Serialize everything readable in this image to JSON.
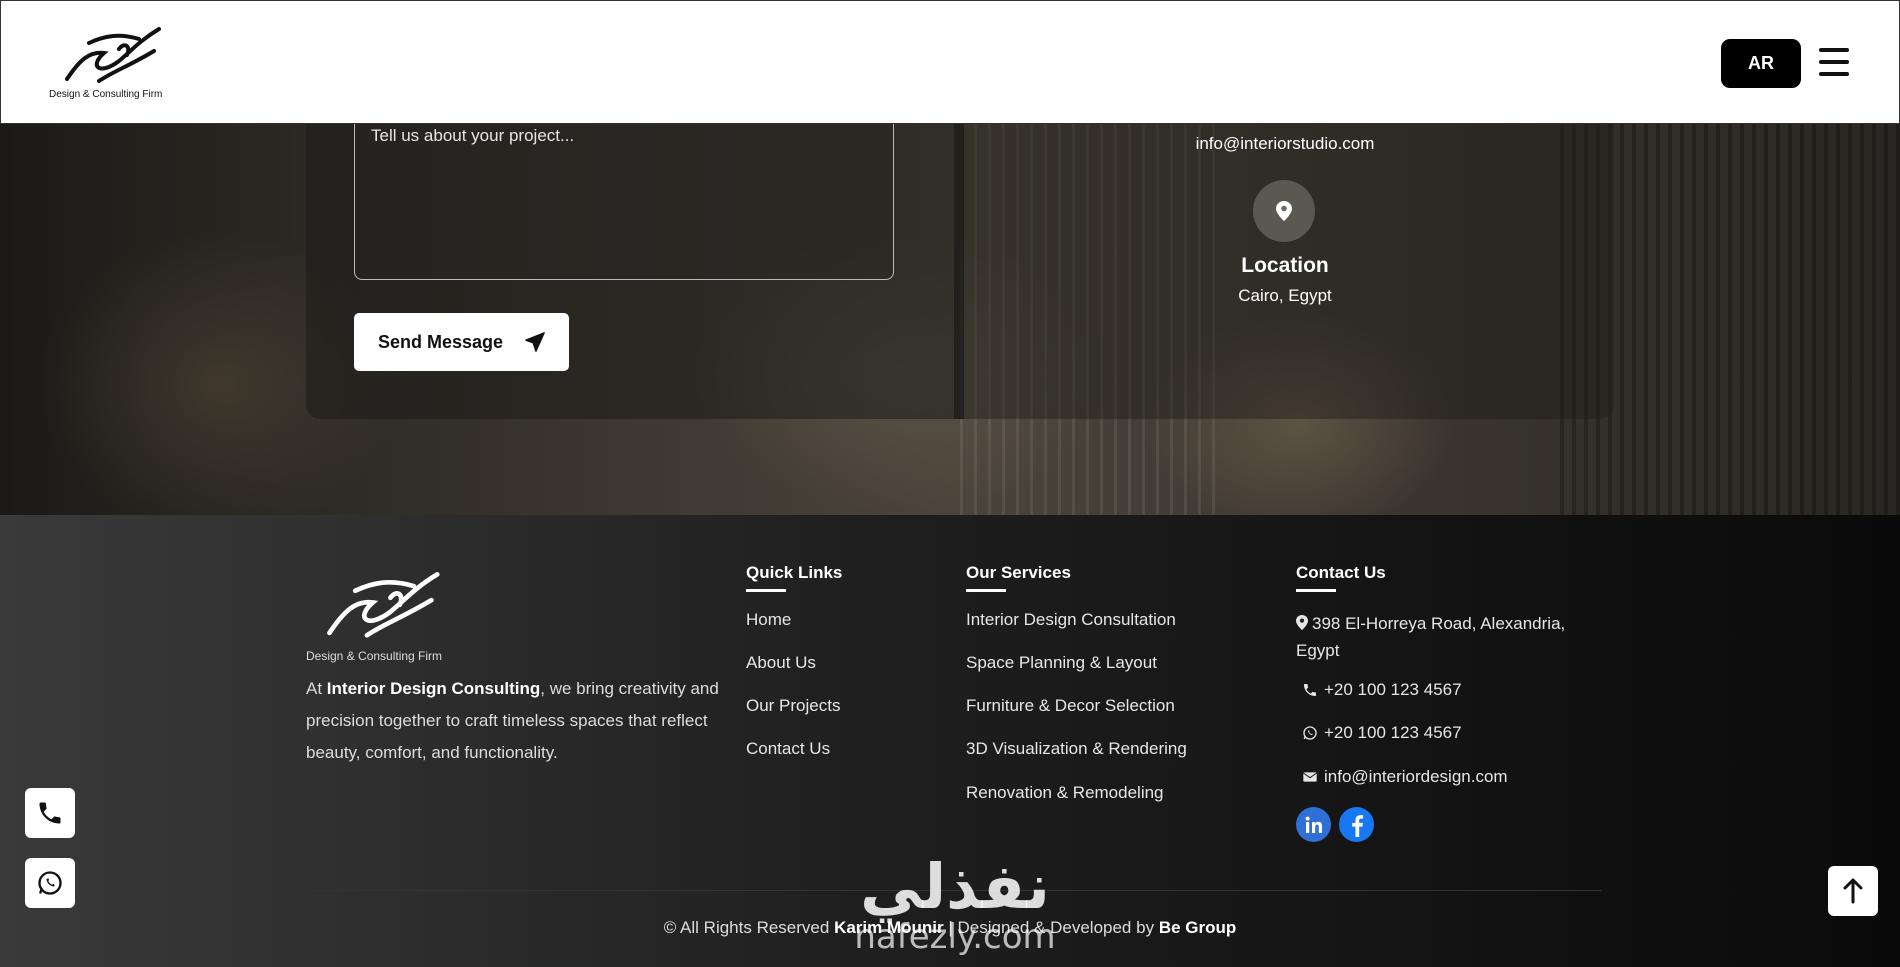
{
  "header": {
    "logo_subtitle": "Design & Consulting Firm",
    "lang_label": "AR"
  },
  "contact_form": {
    "message_placeholder": "Tell us about your project...",
    "send_label": "Send Message"
  },
  "contact_info": {
    "email": "info@interiorstudio.com",
    "location_title": "Location",
    "location_value": "Cairo, Egypt"
  },
  "footer": {
    "logo_subtitle": "Design & Consulting Firm",
    "about_prefix": "At ",
    "about_brand": "Interior Design Consulting",
    "about_suffix": ", we bring creativity and precision together to craft timeless spaces that reflect beauty, comfort, and functionality.",
    "quick_links": {
      "title": "Quick Links",
      "items": [
        "Home",
        "About Us",
        "Our Projects",
        "Contact Us"
      ]
    },
    "services": {
      "title": "Our Services",
      "items": [
        "Interior Design Consultation",
        "Space Planning & Layout",
        "Furniture & Decor Selection",
        "3D Visualization & Rendering",
        "Renovation & Remodeling"
      ]
    },
    "contact": {
      "title": "Contact Us",
      "address": "398 El-Horreya Road, Alexandria, Egypt",
      "phone": "+20 100 123 4567",
      "whatsapp": "+20 100 123 4567",
      "email": "info@interiordesign.com"
    },
    "copyright_prefix": "© All Rights Reserved",
    "copyright_owner": "Karim Mounir",
    "copyright_mid": "| Designed & Developed by",
    "copyright_dev": "Be Group"
  },
  "watermark": {
    "arabic": "نفذلي",
    "latin": "nafezly.com"
  }
}
